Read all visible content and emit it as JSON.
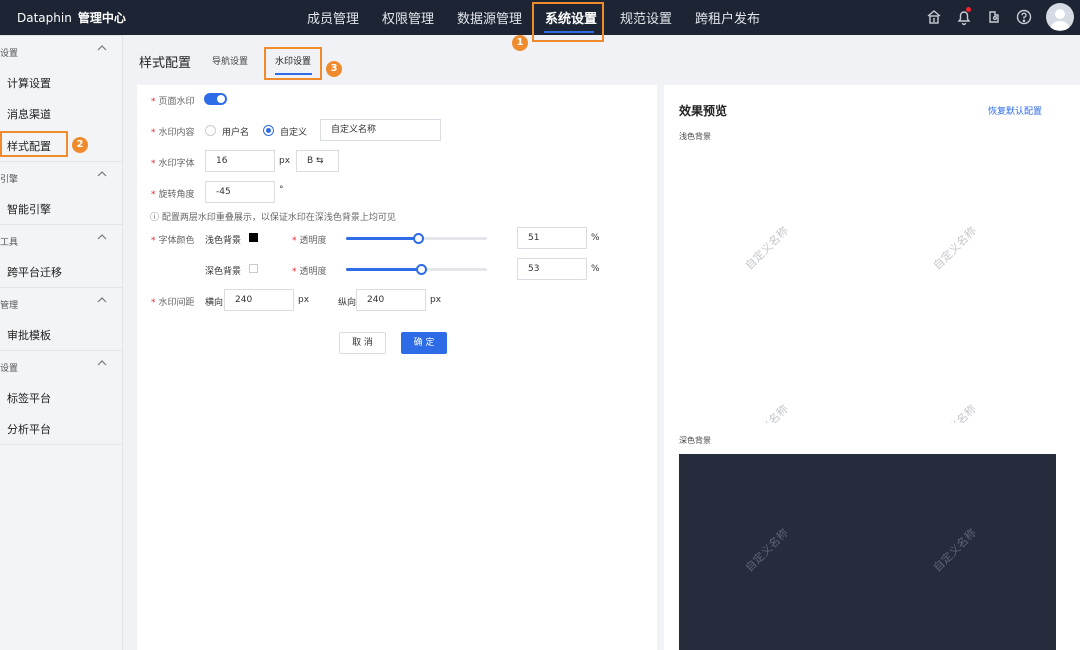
{
  "topbar": {
    "brand": "Dataphin",
    "brand_sub": "管理中心",
    "nav": [
      "成员管理",
      "权限管理",
      "数据源管理",
      "系统设置",
      "规范设置",
      "跨租户发布"
    ],
    "icons": [
      "tenant-icon",
      "bell-icon",
      "plugin-icon",
      "help-icon",
      "user-avatar"
    ]
  },
  "callouts": [
    "1",
    "2",
    "3"
  ],
  "sidebar": {
    "groups": [
      {
        "title": "设置",
        "items": [
          "计算设置",
          "消息渠道",
          "样式配置"
        ]
      },
      {
        "title": "引擎",
        "items": [
          "智能引擎"
        ]
      },
      {
        "title": "工具",
        "items": [
          "跨平台迁移"
        ]
      },
      {
        "title": "管理",
        "items": [
          "审批模板"
        ]
      },
      {
        "title": "设置",
        "items": [
          "标签平台",
          "分析平台"
        ]
      }
    ],
    "active": "样式配置"
  },
  "page": {
    "title": "样式配置",
    "tabs": [
      "导航设置",
      "水印设置"
    ],
    "active_tab": "水印设置"
  },
  "form": {
    "page_watermark_label": "页面水印",
    "page_watermark_on": true,
    "content_label": "水印内容",
    "opt_username": "用户名",
    "opt_custom": "自定义",
    "custom_value": "自定义名称",
    "font_label": "水印字体",
    "font_size": "16",
    "unit_px": "px",
    "bold_toggle": "B ⇆",
    "angle_label": "旋转角度",
    "angle_value": "-45",
    "angle_unit": "°",
    "hint": "ⓘ 配置两层水印重叠展示，以保证水印在深浅色背景上均可见",
    "color_label": "字体颜色",
    "light_bg_label": "浅色背景",
    "dark_bg_label": "深色背景",
    "opacity_label": "透明度",
    "light_opacity": "51",
    "dark_opacity": "53",
    "percent": "%",
    "spacing_label": "水印间距",
    "horizontal_label": "横向",
    "horizontal_value": "240",
    "vertical_label": "纵向",
    "vertical_value": "240",
    "cancel": "取 消",
    "confirm": "确 定"
  },
  "preview": {
    "title": "效果预览",
    "reset": "恢复默认配置",
    "light_label": "浅色背景",
    "dark_label": "深色背景",
    "watermark_text": "自定义名称"
  },
  "colors": {
    "topbar": "#1d2433",
    "accent": "#2e6be6",
    "callout": "#f08b2d",
    "dark_preview": "#262c3b"
  }
}
